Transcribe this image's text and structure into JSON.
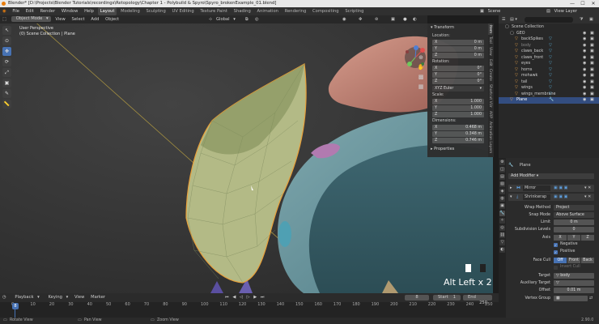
{
  "titlebar": {
    "title": "Blender* [D:\\Projects\\Blender Tutorials\\recordings\\Retopology\\Chapter 1 - Polybuild & Spyro\\Spyro_brokenExample_01.blend]",
    "minimize": "—",
    "maximize": "☐",
    "close": "✕"
  },
  "menubar": {
    "items": [
      "File",
      "Edit",
      "Render",
      "Window",
      "Help"
    ],
    "workspaces": [
      "Layout",
      "Modeling",
      "Sculpting",
      "UV Editing",
      "Texture Paint",
      "Shading",
      "Animation",
      "Rendering",
      "Compositing",
      "Scripting"
    ],
    "active_workspace": "Layout",
    "scene": "Scene",
    "view_layer": "View Layer"
  },
  "viewport_header": {
    "mode": "Object Mode",
    "menus": [
      "View",
      "Select",
      "Add",
      "Object"
    ],
    "orientation": "Global"
  },
  "viewport": {
    "perspective": "User Perspective",
    "collection": "(0) Scene Collection | Plane",
    "overlay_text": "Alt Left x 2"
  },
  "npanel": {
    "transform_title": "Transform",
    "location_label": "Location:",
    "location": {
      "x": "0 m",
      "y": "0 m",
      "z": "0 m"
    },
    "rotation_label": "Rotation:",
    "rotation": {
      "x": "0°",
      "y": "0°",
      "z": "0°"
    },
    "rotation_mode": "XYZ Euler",
    "scale_label": "Scale:",
    "scale": {
      "x": "1.000",
      "y": "1.000",
      "z": "1.000"
    },
    "dimensions_label": "Dimensions:",
    "dimensions": {
      "x": "0.468 m",
      "y": "0.348 m",
      "z": "0.746 m"
    },
    "properties_title": "Properties",
    "axis": {
      "x": "X",
      "y": "Y",
      "z": "Z"
    },
    "tabs": [
      "Item",
      "Tool",
      "View",
      "Edit",
      "Create",
      "Shortcut VUr",
      "ARP",
      "Animation Layers"
    ]
  },
  "outliner": {
    "root": "Scene Collection",
    "items": [
      {
        "name": "GEO",
        "indent": 1
      },
      {
        "name": "backSpikes",
        "indent": 2
      },
      {
        "name": "body",
        "indent": 2
      },
      {
        "name": "claws_back",
        "indent": 2
      },
      {
        "name": "claws_front",
        "indent": 2
      },
      {
        "name": "eyes",
        "indent": 2
      },
      {
        "name": "horns",
        "indent": 2
      },
      {
        "name": "mohawk",
        "indent": 2
      },
      {
        "name": "tail",
        "indent": 2
      },
      {
        "name": "wings",
        "indent": 2
      },
      {
        "name": "wings_membrane",
        "indent": 2
      },
      {
        "name": "Plane",
        "indent": 1,
        "selected": true
      }
    ]
  },
  "properties": {
    "object_name": "Plane",
    "add_modifier": "Add Modifier",
    "modifiers": [
      "Mirror",
      "Shrinkwrap"
    ],
    "wrap_method_label": "Wrap Method",
    "wrap_method": "Project",
    "snap_mode_label": "Snap Mode",
    "snap_mode": "Above Surface",
    "limit_label": "Limit",
    "limit": "0 m",
    "subdiv_label": "Subdivision Levels",
    "subdiv": "0",
    "axis_label": "Axis",
    "axis_options": [
      "X",
      "Y",
      "Z"
    ],
    "negative": "Negative",
    "positive": "Positive",
    "face_cull_label": "Face Cull",
    "face_cull_options": [
      "Off",
      "Front",
      "Back"
    ],
    "invert_cull": "Invert Cull",
    "target_label": "Target",
    "target": "body",
    "aux_target_label": "Auxiliary Target",
    "offset_label": "Offset",
    "offset": "0.01 m",
    "vertex_group_label": "Vertex Group"
  },
  "timeline": {
    "menus": [
      "Playback",
      "Keying",
      "View",
      "Marker"
    ],
    "current_frame": "8",
    "start_label": "Start",
    "start": "1",
    "end_label": "End",
    "end": "250",
    "ruler": [
      "0",
      "10",
      "20",
      "30",
      "40",
      "50",
      "60",
      "70",
      "80",
      "90",
      "100",
      "110",
      "120",
      "130",
      "140",
      "150",
      "160",
      "170",
      "180",
      "190",
      "200",
      "210",
      "220",
      "230",
      "240",
      "250"
    ],
    "playhead": "8"
  },
  "statusbar": {
    "left": "Rotate View",
    "mid": "Pan View",
    "mid2": "Zoom View",
    "version": "2.90.0"
  },
  "colors": {
    "accent": "#4772b3",
    "selection_outline": "#e8a03a",
    "mesh": "#b9c08e",
    "spyro_skin": "#6f9aa3",
    "horn": "#c88a7c"
  }
}
